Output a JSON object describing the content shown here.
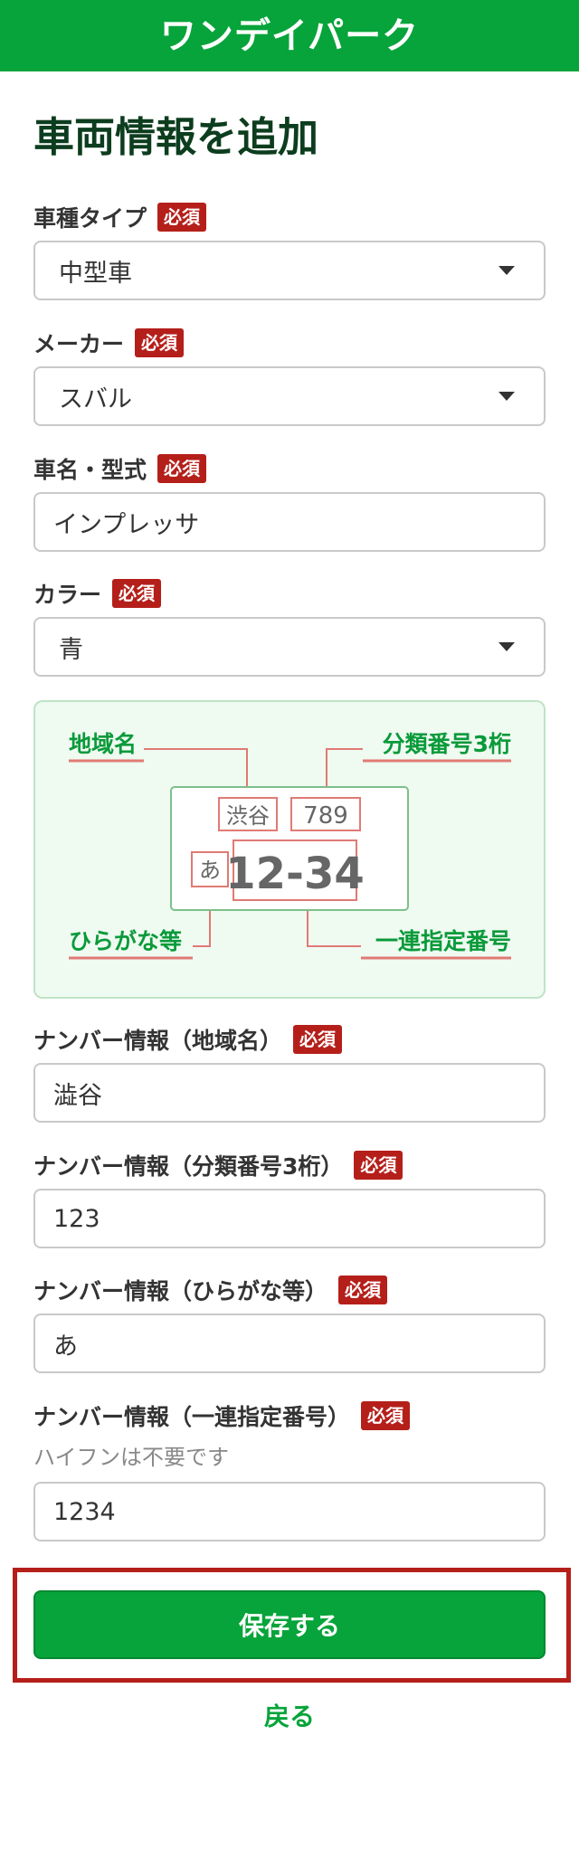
{
  "header": {
    "logo": "ワンデイパーク"
  },
  "page_title": "車両情報を追加",
  "required_badge": "必須",
  "form": {
    "vehicle_type": {
      "label": "車種タイプ",
      "value": "中型車"
    },
    "maker": {
      "label": "メーカー",
      "value": "スバル"
    },
    "model": {
      "label": "車名・型式",
      "value": "インプレッサ"
    },
    "color": {
      "label": "カラー",
      "value": "青"
    },
    "plate_region": {
      "label": "ナンバー情報（地域名）",
      "value": "澁谷"
    },
    "plate_class": {
      "label": "ナンバー情報（分類番号3桁）",
      "value": "123"
    },
    "plate_kana": {
      "label": "ナンバー情報（ひらがな等）",
      "value": "あ"
    },
    "plate_serial": {
      "label": "ナンバー情報（一連指定番号）",
      "hint": "ハイフンは不要です",
      "value": "1234"
    }
  },
  "plate_diagram": {
    "region_label": "地域名",
    "class_label": "分類番号3桁",
    "kana_label": "ひらがな等",
    "serial_label": "一連指定番号",
    "sample_region": "渋谷",
    "sample_class": "789",
    "sample_kana": "あ",
    "sample_serial": "12-34",
    "colors": {
      "label": "#0a9a3a",
      "underline": "#e07a74",
      "plate_border": "#7cc08a",
      "plate_text": "#666666"
    }
  },
  "actions": {
    "save": "保存する",
    "back": "戻る"
  },
  "colors": {
    "brand": "#06a43a",
    "badge": "#b51f1a",
    "highlight_frame": "#b51f1a"
  }
}
